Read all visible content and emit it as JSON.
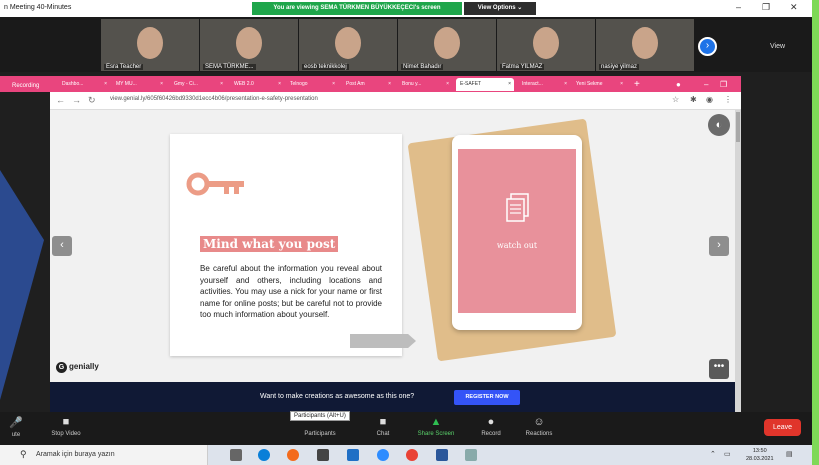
{
  "zoom": {
    "window_title": "n Meeting 40-Minutes",
    "share_banner": "You are viewing SEMA TÜRKMEN BÜYÜKKEÇECI's screen",
    "view_options": "View Options ⌄",
    "view_label": "View",
    "participants": [
      {
        "name": "Esra Teacher"
      },
      {
        "name": "SEMA TÜRKME..."
      },
      {
        "name": "eosb teknikkolej"
      },
      {
        "name": "Nimet Bahadır"
      },
      {
        "name": "Fatma YILMAZ"
      },
      {
        "name": "nasiye yilmaz"
      }
    ],
    "recording": "Recording"
  },
  "browser": {
    "tabs": [
      {
        "label": "Dashbo..."
      },
      {
        "label": "MY MU..."
      },
      {
        "label": "Gmy - Ci..."
      },
      {
        "label": "WEB 2.0"
      },
      {
        "label": "Telnogo"
      },
      {
        "label": "Post Am"
      },
      {
        "label": "Bonu y..."
      },
      {
        "label": "E-SAFET"
      },
      {
        "label": "Interact..."
      },
      {
        "label": "Yeni Sekme"
      }
    ],
    "url": "view.genial.ly/605f60426bd9330d1ecc4b06/presentation-e-safety-presentation"
  },
  "slide": {
    "title": "Mind what you post",
    "body": "Be careful about the information you reveal about yourself and others, including locations and activities. You may use a nick for your name or first name for online posts; but be careful not to provide too much information about yourself.",
    "tablet_label": "watch out",
    "brand": "genially"
  },
  "cta": {
    "text": "Want to make creations as awesome as this one?",
    "button": "REGISTER NOW"
  },
  "toolbar": {
    "mute": "ute",
    "stop_video": "Stop Video",
    "participants": "Participants",
    "tooltip": "Participants (Alt+U)",
    "chat": "Chat",
    "share_screen": "Share Screen",
    "record": "Record",
    "reactions": "Reactions",
    "leave": "Leave"
  },
  "taskbar": {
    "search_placeholder": "Aramak için buraya yazın",
    "time": "13:50",
    "date": "28.03.2021"
  },
  "colors": {
    "share_green": "#1fa64b",
    "tab_pink": "#e9457e",
    "title_pink": "#e88a8a",
    "register_blue": "#3454f7",
    "leave_red": "#e0352b"
  }
}
